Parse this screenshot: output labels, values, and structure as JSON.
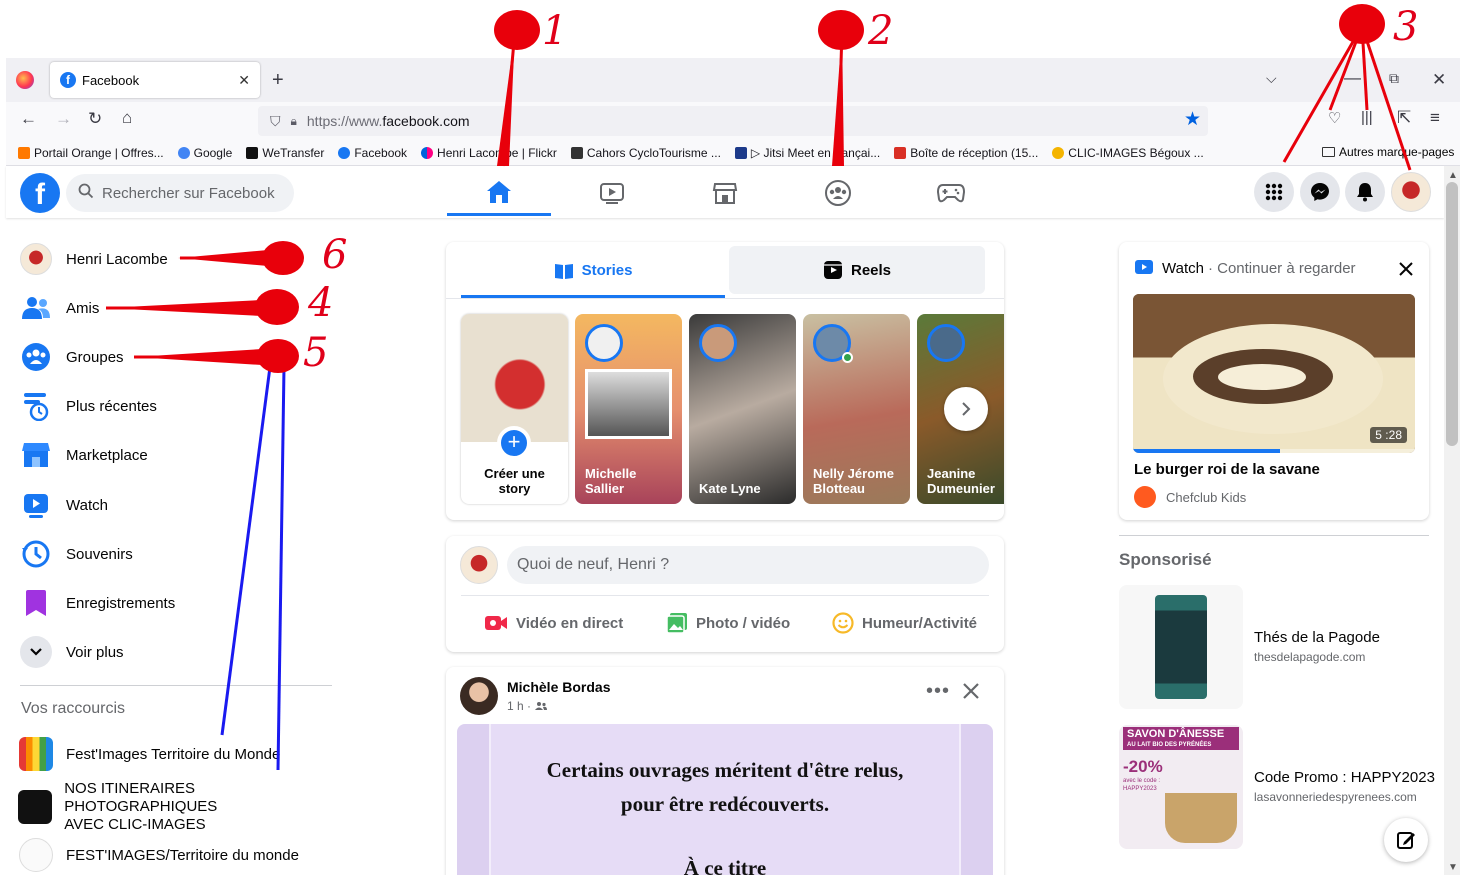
{
  "browser": {
    "tab_title": "Facebook",
    "url_prefix": "https://www.",
    "url_domain": "facebook.com",
    "bookmarks": [
      {
        "label": "Portail Orange | Offres...",
        "color": "#ff7900"
      },
      {
        "label": "Google",
        "color": "#4285f4"
      },
      {
        "label": "WeTransfer",
        "color": "#111111"
      },
      {
        "label": "Facebook",
        "color": "#1877f2"
      },
      {
        "label": "Henri Lacombe | Flickr",
        "color": "#ff0084"
      },
      {
        "label": "Cahors CycloTourisme ...",
        "color": "#333333"
      },
      {
        "label": "▷ Jitsi Meet en françai...",
        "color": "#1d3a8a"
      },
      {
        "label": "Boîte de réception (15...",
        "color": "#d93025"
      },
      {
        "label": "CLIC-IMAGES Bégoux ...",
        "color": "#f4b400"
      }
    ],
    "other_bookmarks": "Autres marque-pages"
  },
  "fb": {
    "logo_letter": "f",
    "search_placeholder": "Rechercher sur Facebook",
    "colors": {
      "brand": "#1877f2"
    }
  },
  "sidebar": {
    "items": [
      {
        "label": "Henri Lacombe",
        "icon": "avatar"
      },
      {
        "label": "Amis",
        "icon": "friends-icon"
      },
      {
        "label": "Groupes",
        "icon": "groups-icon"
      },
      {
        "label": "Plus récentes",
        "icon": "feeds-icon"
      },
      {
        "label": "Marketplace",
        "icon": "marketplace-icon"
      },
      {
        "label": "Watch",
        "icon": "watch-icon"
      },
      {
        "label": "Souvenirs",
        "icon": "memories-icon"
      },
      {
        "label": "Enregistrements",
        "icon": "saved-icon"
      },
      {
        "label": "Voir plus",
        "icon": "chevron-down-icon"
      }
    ],
    "shortcuts_title": "Vos raccourcis",
    "shortcuts": [
      {
        "label": "Fest'Images Territoire du Monde"
      },
      {
        "label": "NOS ITINERAIRES PHOTOGRAPHIQUES",
        "label2": "AVEC CLIC-IMAGES"
      },
      {
        "label": "FEST'IMAGES/Territoire du monde"
      }
    ]
  },
  "stories": {
    "tab_stories": "Stories",
    "tab_reels": "Reels",
    "create_line1": "Créer une",
    "create_line2": "story",
    "items": [
      {
        "line1": "Michelle",
        "line2": "Sallier"
      },
      {
        "line1": "Kate Lyne",
        "line2": ""
      },
      {
        "line1": "Nelly Jérome",
        "line2": "Blotteau"
      },
      {
        "line1": "Jeanine",
        "line2": "Dumeunier"
      }
    ]
  },
  "composer": {
    "placeholder": "Quoi de neuf, Henri ?",
    "live": "Vidéo en direct",
    "photo": "Photo / vidéo",
    "feeling": "Humeur/Activité"
  },
  "post": {
    "author": "Michèle Bordas",
    "meta": "1 h ·",
    "line1": "Certains ouvrages méritent d'être relus,",
    "line2": "pour être redécouverts.",
    "line3": "À ce titre"
  },
  "watch": {
    "title": "Watch",
    "subtitle": "· Continuer à regarder",
    "duration": "5 :28",
    "progress": 0.52,
    "video_title": "Le burger roi de la savane",
    "channel": "Chefclub Kids"
  },
  "sponsored": {
    "title": "Sponsorisé",
    "ads": [
      {
        "name": "Thés de la Pagode",
        "url": "thesdelapagode.com"
      },
      {
        "name": "Code Promo : HAPPY2023",
        "url": "lasavonneriedespyrenees.com",
        "banner": "SAVON D'ÂNESSE",
        "banner2": "AU LAIT BIO DES PYRÉNÉES",
        "promo": "-20%",
        "promo_text": "avec le code : HAPPY2023"
      }
    ]
  },
  "annotations": [
    "1",
    "2",
    "3",
    "4",
    "5",
    "6"
  ]
}
